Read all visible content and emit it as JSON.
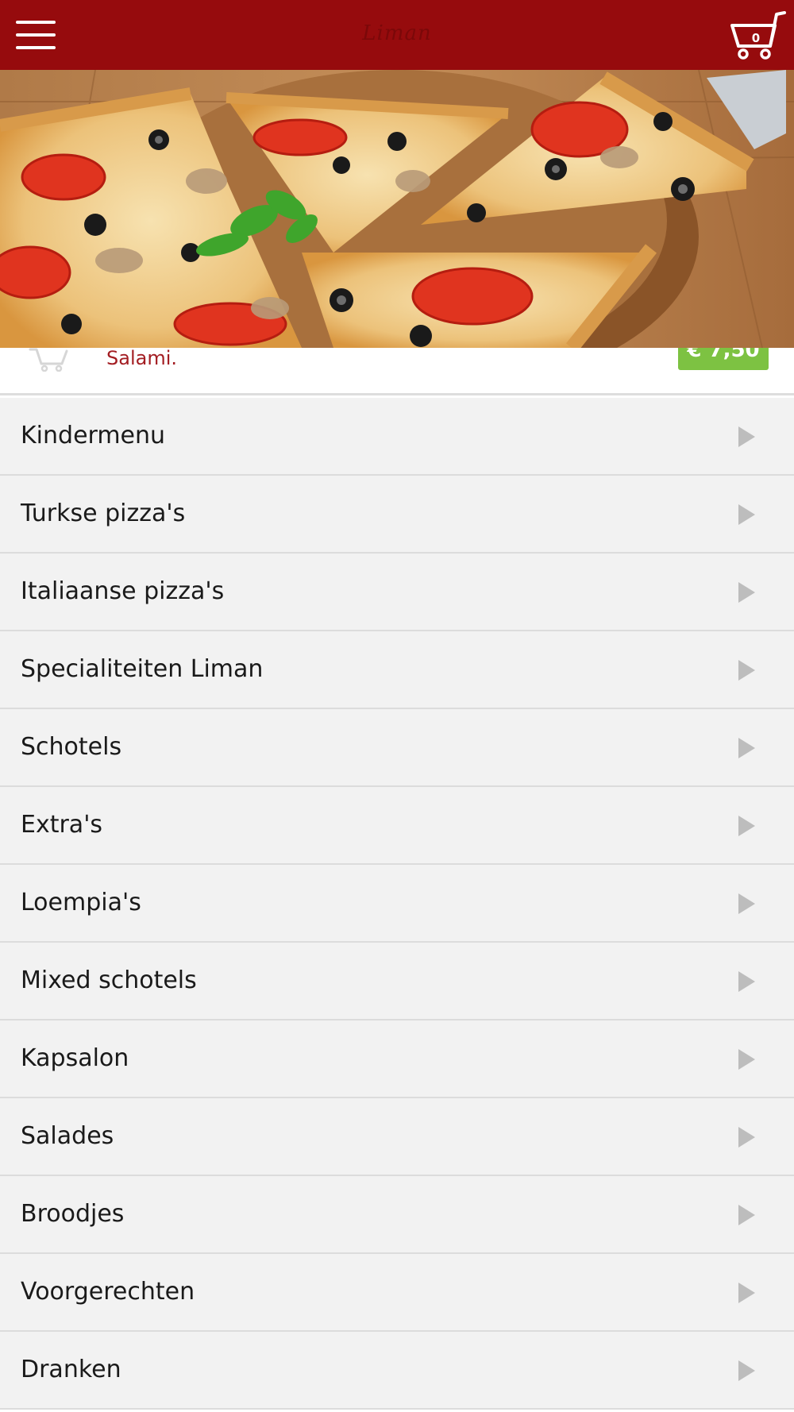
{
  "header": {
    "logo_text": "Liman",
    "cart_count": "0"
  },
  "hero": {
    "image_name": "pizza-photo"
  },
  "product_peek": {
    "description": "Salami.",
    "price": "€ 7,50"
  },
  "categories": [
    {
      "label": "Kindermenu"
    },
    {
      "label": "Turkse pizza's"
    },
    {
      "label": "Italiaanse pizza's"
    },
    {
      "label": "Specialiteiten Liman"
    },
    {
      "label": "Schotels"
    },
    {
      "label": "Extra's"
    },
    {
      "label": "Loempia's"
    },
    {
      "label": "Mixed schotels"
    },
    {
      "label": "Kapsalon"
    },
    {
      "label": "Salades"
    },
    {
      "label": "Broodjes"
    },
    {
      "label": "Voorgerechten"
    },
    {
      "label": "Dranken"
    }
  ],
  "colors": {
    "header_bg": "#960b0d",
    "price_bg": "#7dc242",
    "list_bg": "#f2f2f2",
    "description_text": "#a31d22"
  },
  "icons": {
    "menu": "hamburger-menu-icon",
    "cart": "shopping-cart-icon",
    "arrow": "chevron-right-icon"
  }
}
